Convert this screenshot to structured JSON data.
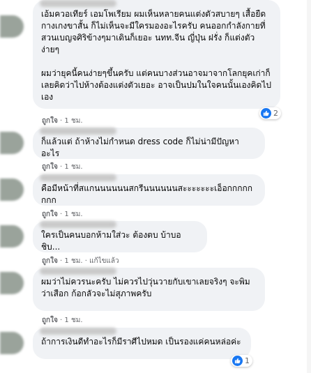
{
  "comments": [
    {
      "text": "เอ้มควอเทียร์ เอมโพเรียม ผมเห็นหลายคนแต่งตัวสบายๆ เสื้อยืด กางเกงขาสั้น ก็ไม่เห็นจะมีใครมองอะไรครับ คนออกกำลังกายที่สวนเบญจศิริข้างๆมาเดินก็เยอะ นทท.จีน ญี่ปุ่น ฝรั่ง ก็แต่งตัวง่ายๆ\n\nผมว่ายุคนี้คนง่ายๆขึ้นครับ แต่คนบางส่วนอาจมาจากโลกยุคเก่าก็เลยคิดว่าไปห้างต้องแต่งตัวเยอะ อาจเป็นปมในใจคนนั้นเองคิดไปเอง",
      "like_label": "ถูกใจ",
      "time": "1 ชม.",
      "edited": "",
      "reaction_count": "2"
    },
    {
      "text": "ก็แล้วแต่ ถ้าห้างไม่กำหนด dress code ก็ไม่น่ามีปัญหาอะไร",
      "like_label": "ถูกใจ",
      "time": "1 ชม.",
      "edited": "",
      "reaction_count": ""
    },
    {
      "text": "คือมีหน้าที่สแกนนนนนนสกรีนนนนนนสะะะะะะะเอ็อกกกกกกกก",
      "like_label": "ถูกใจ",
      "time": "1 ชม.",
      "edited": "",
      "reaction_count": ""
    },
    {
      "text": "ใครเป็นคนบอกห้ามใส่วะ ต้องตบ บ้าบอชิบ...",
      "like_label": "ถูกใจ",
      "time": "1 ชม.",
      "edited": "แก้ไขแล้ว",
      "reaction_count": ""
    },
    {
      "text": "ผมว่าไม่ควรนะครับ ไม่ควรไปวุ่นวายกับเขาเลยจริงๆ จะพิมว่าเสือก ก้อกลัวจะไม่สุภาพครับ",
      "like_label": "ถูกใจ",
      "time": "1 ชม.",
      "edited": "",
      "reaction_count": ""
    },
    {
      "text": "ถ้าการเงินดีทำอะไรก็มีราศีไปหมด เป็นรองแค่คนหล่อค่ะ",
      "like_label": "",
      "time": "",
      "edited": "",
      "reaction_count": "1"
    }
  ],
  "colors": {
    "bubble": "#f0f2f5",
    "meta_text": "#65676b",
    "like_blue": "#1877f2"
  },
  "icons": {
    "reaction": "thumbs-up-icon"
  }
}
